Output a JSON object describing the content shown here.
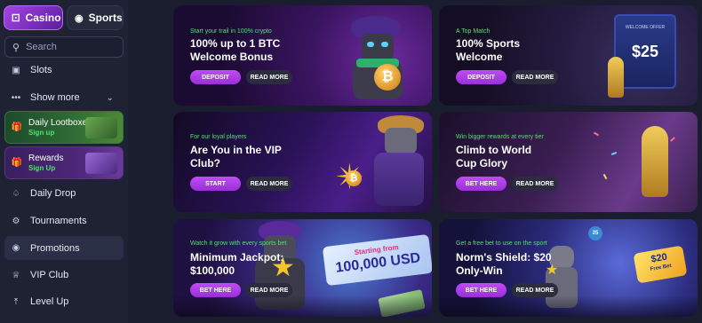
{
  "sidebar": {
    "switch": {
      "casino": "Casino",
      "sports": "Sports"
    },
    "search_placeholder": "Search",
    "slots": "Slots",
    "show_more": "Show more",
    "lootboxes": {
      "title": "Daily Lootboxes",
      "sub": "Sign up"
    },
    "rewards": {
      "title": "Rewards",
      "sub": "Sign Up"
    },
    "daily_drop": "Daily Drop",
    "tournaments": "Tournaments",
    "promotions": "Promotions",
    "vip_club": "VIP Club",
    "level_up": "Level Up"
  },
  "cards": [
    {
      "tag": "Start your trail in 100% crypto",
      "title": "100% up to 1 BTC\nWelcome Bonus",
      "primary": "DEPOSIT",
      "secondary": "READ MORE"
    },
    {
      "tag": "A Top Match",
      "title": "100% Sports\nWelcome",
      "primary": "DEPOSIT",
      "secondary": "READ MORE",
      "art": {
        "banner": "WELCOME OFFER",
        "amount": "$25"
      }
    },
    {
      "tag": "For our loyal players",
      "title": "Are You in the VIP\nClub?",
      "primary": "START",
      "secondary": "READ MORE"
    },
    {
      "tag": "Win bigger rewards at every tier",
      "title": "Climb to World\nCup Glory",
      "primary": "BET HERE",
      "secondary": "READ MORE"
    },
    {
      "tag": "Watch it grow with every sports bet",
      "title": "Minimum Jackpot:\n$100,000",
      "primary": "BET HERE",
      "secondary": "READ MORE",
      "art": {
        "line1": "Starting from",
        "line2": "100,000 USD"
      }
    },
    {
      "tag": "Get a free bet to use on the sport",
      "title": "Norm's Shield: $20\nOnly-Win",
      "primary": "BET HERE",
      "secondary": "READ MORE",
      "art": {
        "ticket_amount": "$20",
        "ticket_text": "Free Bet",
        "badge": "25"
      }
    }
  ],
  "colors": {
    "accent": "#b13ef0",
    "tag_green": "#4fe06a",
    "sidebar_bg": "#1f2233"
  }
}
